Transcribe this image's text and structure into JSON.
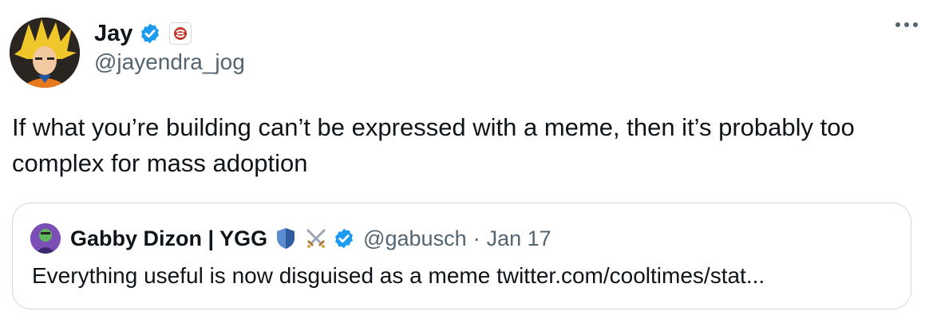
{
  "author": {
    "name": "Jay",
    "handle": "@jayendra_jog",
    "verified_icon": "verified-badge-icon",
    "affiliate_icon": "affiliate-logo-icon"
  },
  "tweet": {
    "text": "If what you’re building can’t be expressed with a meme, then it’s probably too complex for mass adoption"
  },
  "menu": {
    "icon": "more-options-icon"
  },
  "quoted_tweet": {
    "author_name": "Gabby Dizon | YGG",
    "author_emojis": [
      "shield-emoji",
      "crossed-swords-emoji"
    ],
    "handle": "@gabusch",
    "separator": "·",
    "date": "Jan 17",
    "text": "Everything useful is now disguised as a meme twitter.com/cooltimes/stat..."
  },
  "colors": {
    "text_primary": "#0f1419",
    "text_secondary": "#536471",
    "verified_blue": "#1d9bf0",
    "border": "#cfd9de"
  }
}
